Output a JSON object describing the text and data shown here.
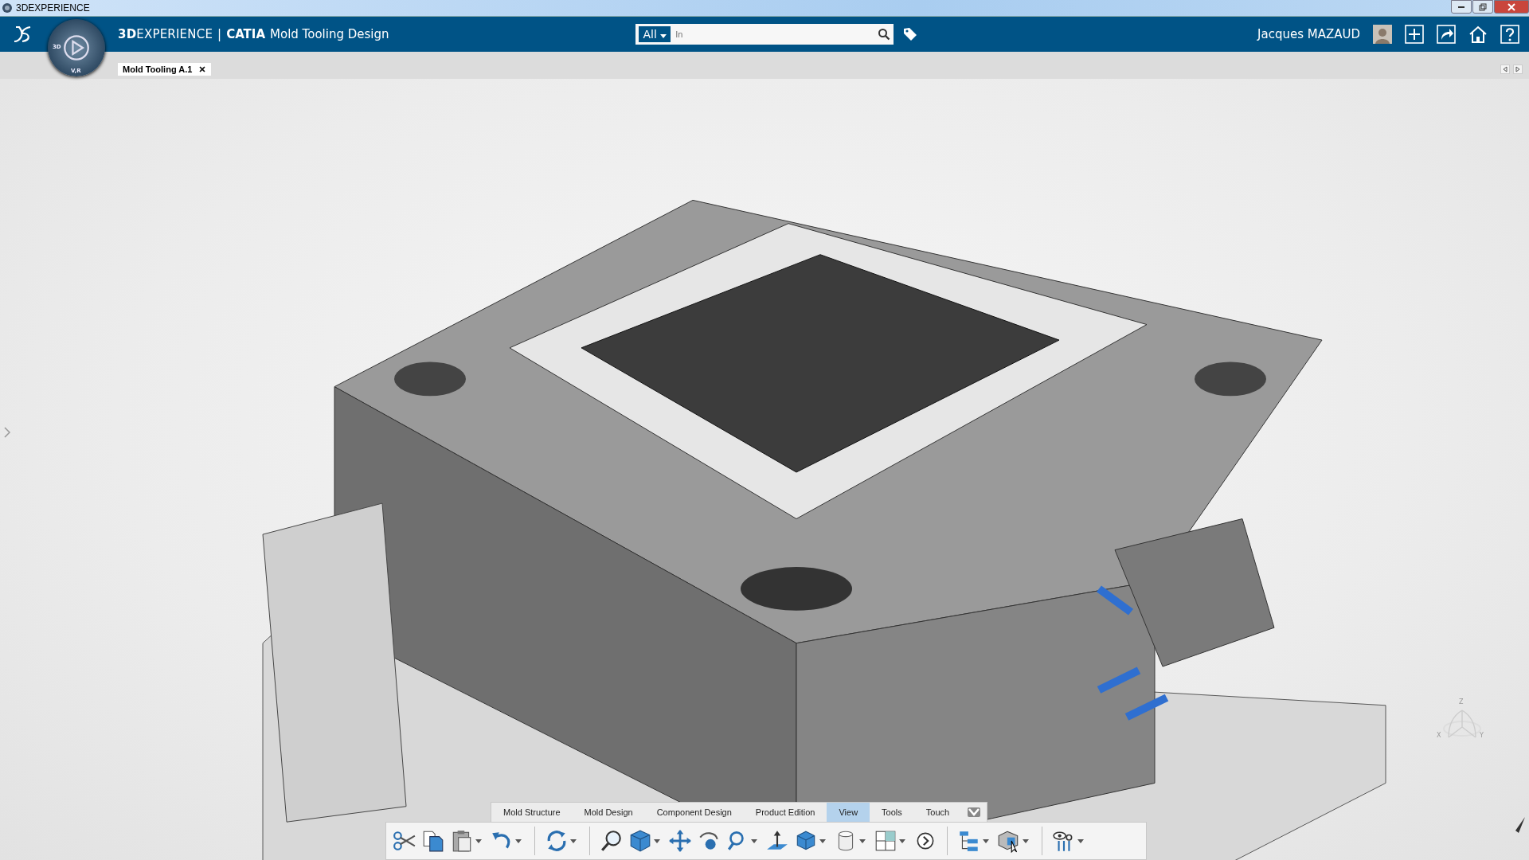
{
  "window": {
    "title": "3DEXPERIENCE"
  },
  "header": {
    "brand": "**3D**EXPERIENCE",
    "divider": "|",
    "app_brand": "CATIA",
    "app_name": "Mold Tooling Design",
    "compass_labels": [
      "3D",
      "V,R"
    ],
    "search": {
      "scope": "All",
      "placeholder": "In"
    },
    "user": "Jacques MAZAUD"
  },
  "document_tabs": [
    {
      "label": "Mold Tooling A.1",
      "selected": true
    }
  ],
  "action_bar": {
    "tabs": [
      {
        "label": "Mold Structure",
        "selected": false
      },
      {
        "label": "Mold Design",
        "selected": false
      },
      {
        "label": "Component Design",
        "selected": false
      },
      {
        "label": "Product Edition",
        "selected": false
      },
      {
        "label": "View",
        "selected": true
      },
      {
        "label": "Tools",
        "selected": false
      },
      {
        "label": "Touch",
        "selected": false
      }
    ],
    "tools": [
      {
        "kind": "cut",
        "dropdown": false
      },
      {
        "kind": "copy",
        "dropdown": false
      },
      {
        "kind": "paste",
        "dropdown": true
      },
      {
        "kind": "undo",
        "dropdown": true
      },
      {
        "kind": "separator"
      },
      {
        "kind": "refresh",
        "dropdown": true
      },
      {
        "kind": "separator"
      },
      {
        "kind": "fit",
        "dropdown": false
      },
      {
        "kind": "cube",
        "dropdown": true
      },
      {
        "kind": "pan",
        "dropdown": false
      },
      {
        "kind": "rotate",
        "dropdown": false
      },
      {
        "kind": "zoom",
        "dropdown": true
      },
      {
        "kind": "normal",
        "dropdown": false
      },
      {
        "kind": "render",
        "dropdown": true
      },
      {
        "kind": "cylinder",
        "dropdown": true
      },
      {
        "kind": "layout",
        "dropdown": true
      },
      {
        "kind": "more",
        "dropdown": false
      },
      {
        "kind": "separator"
      },
      {
        "kind": "tree",
        "dropdown": true
      },
      {
        "kind": "select",
        "dropdown": true
      },
      {
        "kind": "separator"
      },
      {
        "kind": "inspect",
        "dropdown": true
      }
    ]
  },
  "axis_labels": [
    "Z",
    "X",
    "Y"
  ]
}
